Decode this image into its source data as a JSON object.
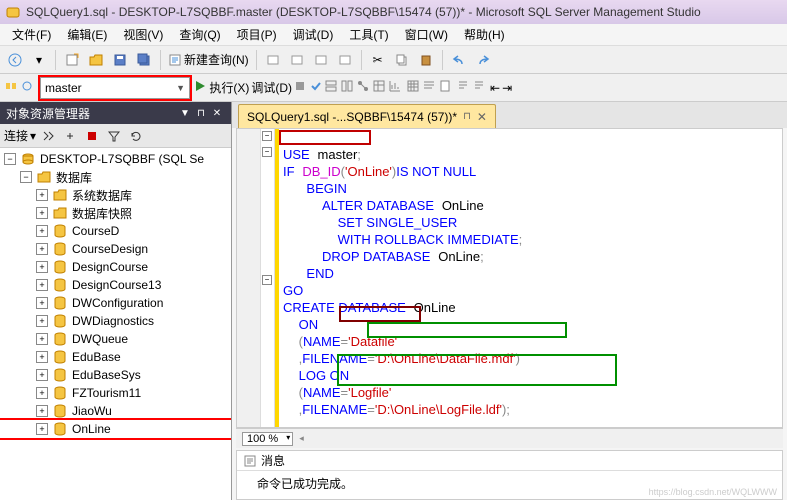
{
  "title": "SQLQuery1.sql - DESKTOP-L7SQBBF.master (DESKTOP-L7SQBBF\\15474 (57))* - Microsoft SQL Server Management Studio",
  "menu": {
    "file": "文件(F)",
    "edit": "编辑(E)",
    "view": "视图(V)",
    "query": "查询(Q)",
    "project": "项目(P)",
    "debug": "调试(D)",
    "tools": "工具(T)",
    "window": "窗口(W)",
    "help": "帮助(H)"
  },
  "toolbar1": {
    "new_query": "新建查询(N)"
  },
  "toolbar2": {
    "database": "master",
    "execute": "执行(X)",
    "debug": "调试(D)"
  },
  "explorer": {
    "title": "对象资源管理器",
    "connect_label": "连接",
    "server": "DESKTOP-L7SQBBF (SQL Se",
    "databases_folder": "数据库",
    "system_db": "系统数据库",
    "db_snapshots": "数据库快照",
    "items": [
      "CourseD",
      "CourseDesign",
      "DesignCourse",
      "DesignCourse13",
      "DWConfiguration",
      "DWDiagnostics",
      "DWQueue",
      "EduBase",
      "EduBaseSys",
      "FZTourism11",
      "JiaoWu",
      "OnLine"
    ]
  },
  "tab": {
    "label": "SQLQuery1.sql -...SQBBF\\15474 (57))*"
  },
  "sql": {
    "l1_use": "USE",
    "l1_db": "master",
    "l2_if": "IF",
    "l2_func": "DB_ID",
    "l2_arg": "'OnLine'",
    "l2_tail": "IS NOT NULL",
    "l3": "BEGIN",
    "l4": "ALTER DATABASE",
    "l4_db": "OnLine",
    "l5": "SET SINGLE_USER",
    "l6": "WITH ROLLBACK IMMEDIATE",
    "l7": "DROP DATABASE",
    "l7_db": "OnLine",
    "l8": "END",
    "l9": "GO",
    "l10": "CREATE DATABASE",
    "l10_db": "OnLine",
    "l11": "ON",
    "l12_name": "NAME",
    "l12_val": "'Datafile'",
    "l13_fname": "FILENAME",
    "l13_val": "'D:\\OnLine\\DataFile.mdf'",
    "l14": "LOG ON",
    "l15_name": "NAME",
    "l15_val": "'Logfile'",
    "l16_fname": "FILENAME",
    "l16_val": "'D:\\OnLine\\LogFile.ldf'"
  },
  "zoom": "100 %",
  "output": {
    "tab_label": "消息",
    "message": "命令已成功完成。"
  },
  "watermark": "https://blog.csdn.net/WQLWWW"
}
